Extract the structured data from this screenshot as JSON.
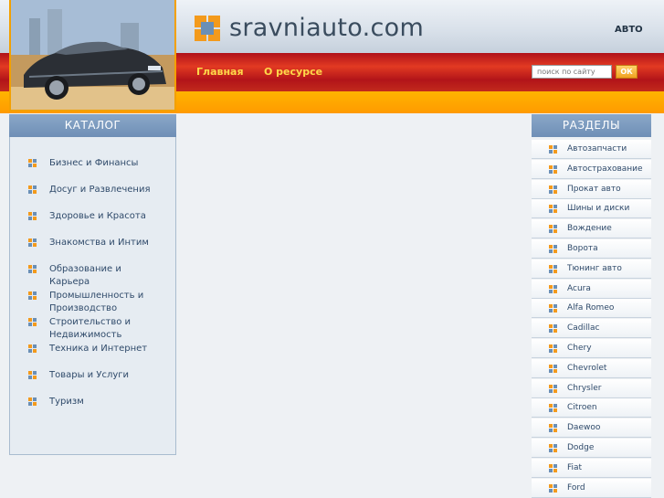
{
  "site": {
    "logo_text": "sravniauto.com",
    "category": "АВТО"
  },
  "nav": {
    "items": [
      {
        "label": "Главная"
      },
      {
        "label": "О ресурсе"
      }
    ]
  },
  "search": {
    "placeholder": "поиск по сайту",
    "button_label": "ОК"
  },
  "catalog": {
    "title": "КАТАЛОГ",
    "items": [
      {
        "label": "Бизнес и Финансы"
      },
      {
        "label": "Досуг и Развлечения"
      },
      {
        "label": "Здоровье и Красота"
      },
      {
        "label": "Знакомства и Интим"
      },
      {
        "label": "Образование и Карьера"
      },
      {
        "label": "Промышленность и Производство"
      },
      {
        "label": "Строительство и Недвижимость"
      },
      {
        "label": "Техника и Интернет"
      },
      {
        "label": "Товары и Услуги"
      },
      {
        "label": "Туризм"
      }
    ]
  },
  "sections": {
    "title": "РАЗДЕЛЫ",
    "items": [
      {
        "label": "Автозапчасти"
      },
      {
        "label": "Автострахование"
      },
      {
        "label": "Прокат авто"
      },
      {
        "label": "Шины и диски"
      },
      {
        "label": "Вождение"
      },
      {
        "label": "Ворота"
      },
      {
        "label": "Тюнинг авто"
      },
      {
        "label": "Acura"
      },
      {
        "label": "Alfa Romeo"
      },
      {
        "label": "Cadillac"
      },
      {
        "label": "Chery"
      },
      {
        "label": "Chevrolet"
      },
      {
        "label": "Chrysler"
      },
      {
        "label": "Citroen"
      },
      {
        "label": "Daewoo"
      },
      {
        "label": "Dodge"
      },
      {
        "label": "Fiat"
      },
      {
        "label": "Ford"
      }
    ]
  },
  "colors": {
    "header_red": "#c21a1c",
    "accent_orange": "#ff9f00",
    "panel_blue": "#7896bd",
    "link_text": "#2f4a6a"
  }
}
